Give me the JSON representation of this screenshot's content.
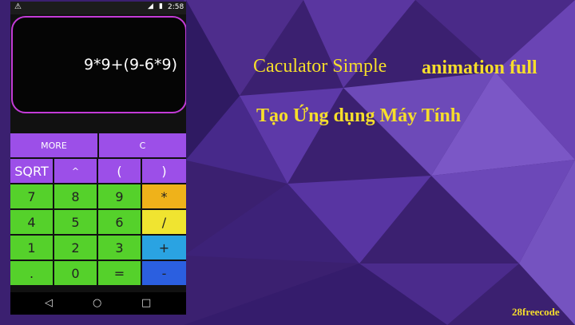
{
  "status_bar": {
    "warning_icon": "warning-icon",
    "signal_icon": "signal-icon",
    "battery_icon": "battery-icon",
    "time": "2:58"
  },
  "display": {
    "expression": "9*9+(9-6*9)"
  },
  "keypad": {
    "row1": [
      "MORE",
      "C"
    ],
    "row2": [
      "SQRT",
      "^",
      "(",
      ")"
    ],
    "row3": [
      "7",
      "8",
      "9",
      "*"
    ],
    "row4": [
      "4",
      "5",
      "6",
      "/"
    ],
    "row5": [
      "1",
      "2",
      "3",
      "+"
    ],
    "row6": [
      ".",
      "0",
      "=",
      "-"
    ]
  },
  "nav_bar": {
    "back": "◁",
    "home": "○",
    "recents": "□"
  },
  "headline": {
    "title": "Caculator Simple",
    "subtitle": "animation full",
    "vietnamese": "Tạo Ứng dụng Máy Tính"
  },
  "watermark": "28freecode",
  "colors": {
    "purple_key": "#9c4fe8",
    "green_key": "#55d12b",
    "orange_key": "#efb21a",
    "yellow_key": "#f0e430",
    "cyan_key": "#2aa3e2",
    "blue_key": "#2b5fe0",
    "title_yellow": "#f6de2b"
  }
}
